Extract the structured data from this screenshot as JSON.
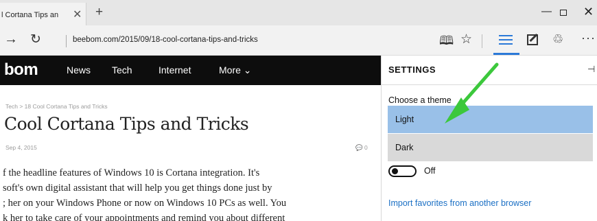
{
  "browser": {
    "tab_title": "l Cortana Tips an",
    "tab_close": "✕",
    "new_tab": "+",
    "win_min": "—",
    "win_close": "✕",
    "url": "beebom.com/2015/09/18-cool-cortana-tips-and-tricks",
    "back_glyph": "→",
    "refresh_glyph": "↻",
    "reading_glyph": "🕮",
    "favorite_glyph": "☆",
    "share_glyph": "♲",
    "more_glyph": "···"
  },
  "site": {
    "logo": "bom",
    "nav": [
      "News",
      "Tech",
      "Internet",
      "More ⌄"
    ]
  },
  "article": {
    "breadcrumb": "Tech  >  18 Cool Cortana Tips and Tricks",
    "title": "Cool Cortana Tips and Tricks",
    "date": "Sep 4, 2015",
    "comments": "💬 0",
    "lines": [
      "f the headline features of Windows 10 is Cortana integration. It's",
      "soft's own digital assistant that will help you get things done just by",
      "; her on your Windows Phone or now on Windows 10 PCs as well. You",
      "k her to take care of your appointments and remind you about different"
    ]
  },
  "settings": {
    "title": "SETTINGS",
    "pin_glyph": "⊣",
    "theme_label": "Choose a theme",
    "theme_options": [
      "Light",
      "Dark"
    ],
    "selected_theme": "Light",
    "toggle_label": "Off",
    "toggle_on": false,
    "import_link": "Import favorites from another browser"
  },
  "colors": {
    "accent": "#2b79d8",
    "selected_option": "#99c0e8",
    "option": "#d9d9d9",
    "arrow": "#3cc83c"
  }
}
